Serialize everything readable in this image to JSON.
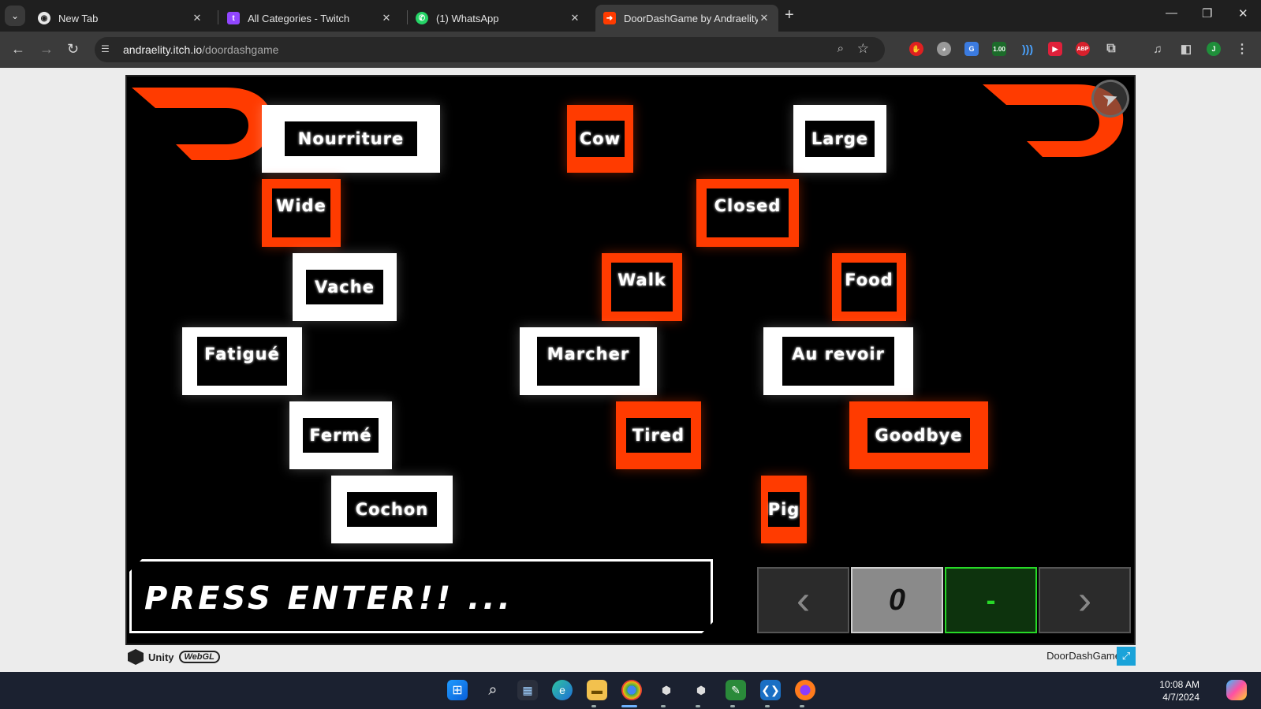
{
  "browser": {
    "tabs": [
      {
        "title": "New Tab",
        "icon": "chrome-icon",
        "active": false
      },
      {
        "title": "All Categories - Twitch",
        "icon": "twitch-icon",
        "active": false
      },
      {
        "title": "(1) WhatsApp",
        "icon": "whatsapp-icon",
        "active": false
      },
      {
        "title": "DoorDashGame by Andraelity",
        "icon": "doordash-icon",
        "active": true
      }
    ],
    "url_host": "andraelity.itch.io",
    "url_path": "/doordashgame",
    "extension_badge": "1.00",
    "extension_abp": "ABP"
  },
  "game": {
    "words": [
      {
        "text": "Nourriture",
        "style": "white"
      },
      {
        "text": "Cow",
        "style": "orange"
      },
      {
        "text": "Large",
        "style": "white"
      },
      {
        "text": "Wide",
        "style": "orange"
      },
      {
        "text": "Closed",
        "style": "orange"
      },
      {
        "text": "Vache",
        "style": "white"
      },
      {
        "text": "Walk",
        "style": "orange"
      },
      {
        "text": "Food",
        "style": "orange"
      },
      {
        "text": "Fatigué",
        "style": "white"
      },
      {
        "text": "Marcher",
        "style": "white"
      },
      {
        "text": "Au revoir",
        "style": "white"
      },
      {
        "text": "Fermé",
        "style": "white"
      },
      {
        "text": "Tired",
        "style": "orange"
      },
      {
        "text": "Goodbye",
        "style": "orange"
      },
      {
        "text": "Cochon",
        "style": "white"
      },
      {
        "text": "Pig",
        "style": "orange"
      }
    ],
    "prompt": "PRESS ENTER!! ...",
    "counter": "0",
    "green_value": "-",
    "colors": {
      "orange": "#ff3b00",
      "green": "#27d927"
    }
  },
  "footer": {
    "unity_label": "Unity",
    "webgl_label": "WebGL",
    "game_name": "DoorDashGame"
  },
  "taskbar": {
    "time": "10:08 AM",
    "date": "4/7/2024"
  }
}
